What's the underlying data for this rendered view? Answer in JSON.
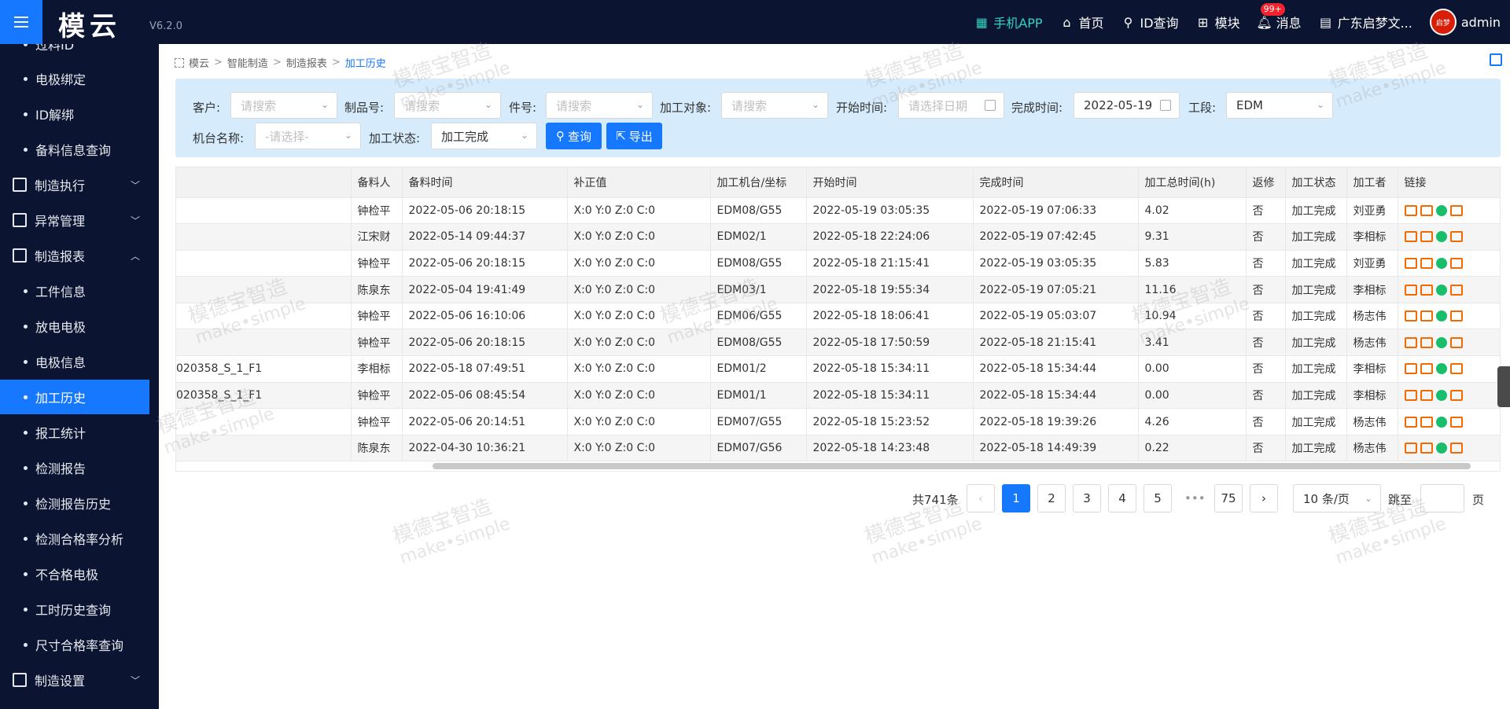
{
  "app": {
    "logo": "模云",
    "version": "V6.2.0"
  },
  "topnav": {
    "app_label": "手机APP",
    "home_label": "首页",
    "id_query_label": "ID查询",
    "modules_label": "模块",
    "messages_label": "消息",
    "messages_badge": "99+",
    "company_label": "广东启梦文...",
    "user_label": "admin",
    "avatar_text": "启梦"
  },
  "sidebar": {
    "items": [
      {
        "label": "过料ID",
        "kind": "sub"
      },
      {
        "label": "电极绑定",
        "kind": "sub"
      },
      {
        "label": "ID解绑",
        "kind": "sub"
      },
      {
        "label": "备料信息查询",
        "kind": "sub"
      },
      {
        "label": "制造执行",
        "kind": "group"
      },
      {
        "label": "异常管理",
        "kind": "group"
      },
      {
        "label": "制造报表",
        "kind": "group"
      },
      {
        "label": "工件信息",
        "kind": "sub"
      },
      {
        "label": "放电电极",
        "kind": "sub"
      },
      {
        "label": "电极信息",
        "kind": "sub"
      },
      {
        "label": "加工历史",
        "kind": "sub",
        "active": true
      },
      {
        "label": "报工统计",
        "kind": "sub"
      },
      {
        "label": "检测报告",
        "kind": "sub"
      },
      {
        "label": "检测报告历史",
        "kind": "sub"
      },
      {
        "label": "检测合格率分析",
        "kind": "sub"
      },
      {
        "label": "不合格电极",
        "kind": "sub"
      },
      {
        "label": "工时历史查询",
        "kind": "sub"
      },
      {
        "label": "尺寸合格率查询",
        "kind": "sub"
      },
      {
        "label": "制造设置",
        "kind": "group"
      }
    ]
  },
  "breadcrumb": {
    "b1": "模云",
    "b2": "智能制造",
    "b3": "制造报表",
    "current": "加工历史"
  },
  "filter": {
    "customer_label": "客户:",
    "customer_placeholder": "请搜索",
    "product_label": "制品号:",
    "product_placeholder": "请搜索",
    "part_label": "件号:",
    "part_placeholder": "请搜索",
    "object_label": "加工对象:",
    "object_placeholder": "请搜索",
    "start_label": "开始时间:",
    "start_placeholder": "请选择日期",
    "end_label": "完成时间:",
    "end_value": "2022-05-19",
    "section_label": "工段:",
    "section_value": "EDM",
    "machine_label": "机台名称:",
    "machine_placeholder": "-请选择-",
    "status_label": "加工状态:",
    "status_value": "加工完成",
    "query_button": "查询",
    "export_button": "导出"
  },
  "table": {
    "columns": [
      "",
      "备料人",
      "备料时间",
      "补正值",
      "加工机台/坐标",
      "开始时间",
      "完成时间",
      "加工总时间(h)",
      "返修",
      "加工状态",
      "加工者",
      "链接"
    ],
    "rows": [
      [
        "",
        "钟检平",
        "2022-05-06 20:18:15",
        "X:0 Y:0 Z:0 C:0",
        "EDM08/G55",
        "2022-05-19 03:05:35",
        "2022-05-19 07:06:33",
        "4.02",
        "否",
        "加工完成",
        "刘亚勇"
      ],
      [
        "",
        "江宋财",
        "2022-05-14 09:44:37",
        "X:0 Y:0 Z:0 C:0",
        "EDM02/1",
        "2022-05-18 22:24:06",
        "2022-05-19 07:42:45",
        "9.31",
        "否",
        "加工完成",
        "李相标"
      ],
      [
        "",
        "钟检平",
        "2022-05-06 20:18:15",
        "X:0 Y:0 Z:0 C:0",
        "EDM08/G55",
        "2022-05-18 21:15:41",
        "2022-05-19 03:05:35",
        "5.83",
        "否",
        "加工完成",
        "刘亚勇"
      ],
      [
        "",
        "陈泉东",
        "2022-05-04 19:41:49",
        "X:0 Y:0 Z:0 C:0",
        "EDM03/1",
        "2022-05-18 19:55:34",
        "2022-05-19 07:05:21",
        "11.16",
        "否",
        "加工完成",
        "李相标"
      ],
      [
        "",
        "钟检平",
        "2022-05-06 16:10:06",
        "X:0 Y:0 Z:0 C:0",
        "EDM06/G55",
        "2022-05-18 18:06:41",
        "2022-05-19 05:03:07",
        "10.94",
        "否",
        "加工完成",
        "杨志伟"
      ],
      [
        "",
        "钟检平",
        "2022-05-06 20:18:15",
        "X:0 Y:0 Z:0 C:0",
        "EDM08/G55",
        "2022-05-18 17:50:59",
        "2022-05-18 21:15:41",
        "3.41",
        "否",
        "加工完成",
        "杨志伟"
      ],
      [
        "020358_S_1_F1",
        "李相标",
        "2022-05-18 07:49:51",
        "X:0 Y:0 Z:0 C:0",
        "EDM01/2",
        "2022-05-18 15:34:11",
        "2022-05-18 15:34:44",
        "0.00",
        "否",
        "加工完成",
        "李相标"
      ],
      [
        "020358_S_1_F1",
        "钟检平",
        "2022-05-06 08:45:54",
        "X:0 Y:0 Z:0 C:0",
        "EDM01/1",
        "2022-05-18 15:34:11",
        "2022-05-18 15:34:44",
        "0.00",
        "否",
        "加工完成",
        "李相标"
      ],
      [
        "",
        "钟检平",
        "2022-05-06 20:14:51",
        "X:0 Y:0 Z:0 C:0",
        "EDM07/G55",
        "2022-05-18 15:23:52",
        "2022-05-18 19:39:26",
        "4.26",
        "否",
        "加工完成",
        "杨志伟"
      ],
      [
        "",
        "陈泉东",
        "2022-04-30 10:36:21",
        "X:0 Y:0 Z:0 C:0",
        "EDM07/G56",
        "2022-05-18 14:23:48",
        "2022-05-18 14:49:39",
        "0.22",
        "否",
        "加工完成",
        "杨志伟"
      ]
    ]
  },
  "pagination": {
    "total": "共741条",
    "pages": [
      "1",
      "2",
      "3",
      "4",
      "5"
    ],
    "ellipsis": "•••",
    "last": "75",
    "page_size": "10 条/页",
    "jump_label": "跳至",
    "page_suffix": "页"
  },
  "watermark": {
    "cn": "模德宝智造",
    "en": "make•simple"
  },
  "colors": {
    "accent": "#1677ff",
    "sidebar_bg": "#0b1430",
    "filter_bg": "#d6ebfb"
  }
}
